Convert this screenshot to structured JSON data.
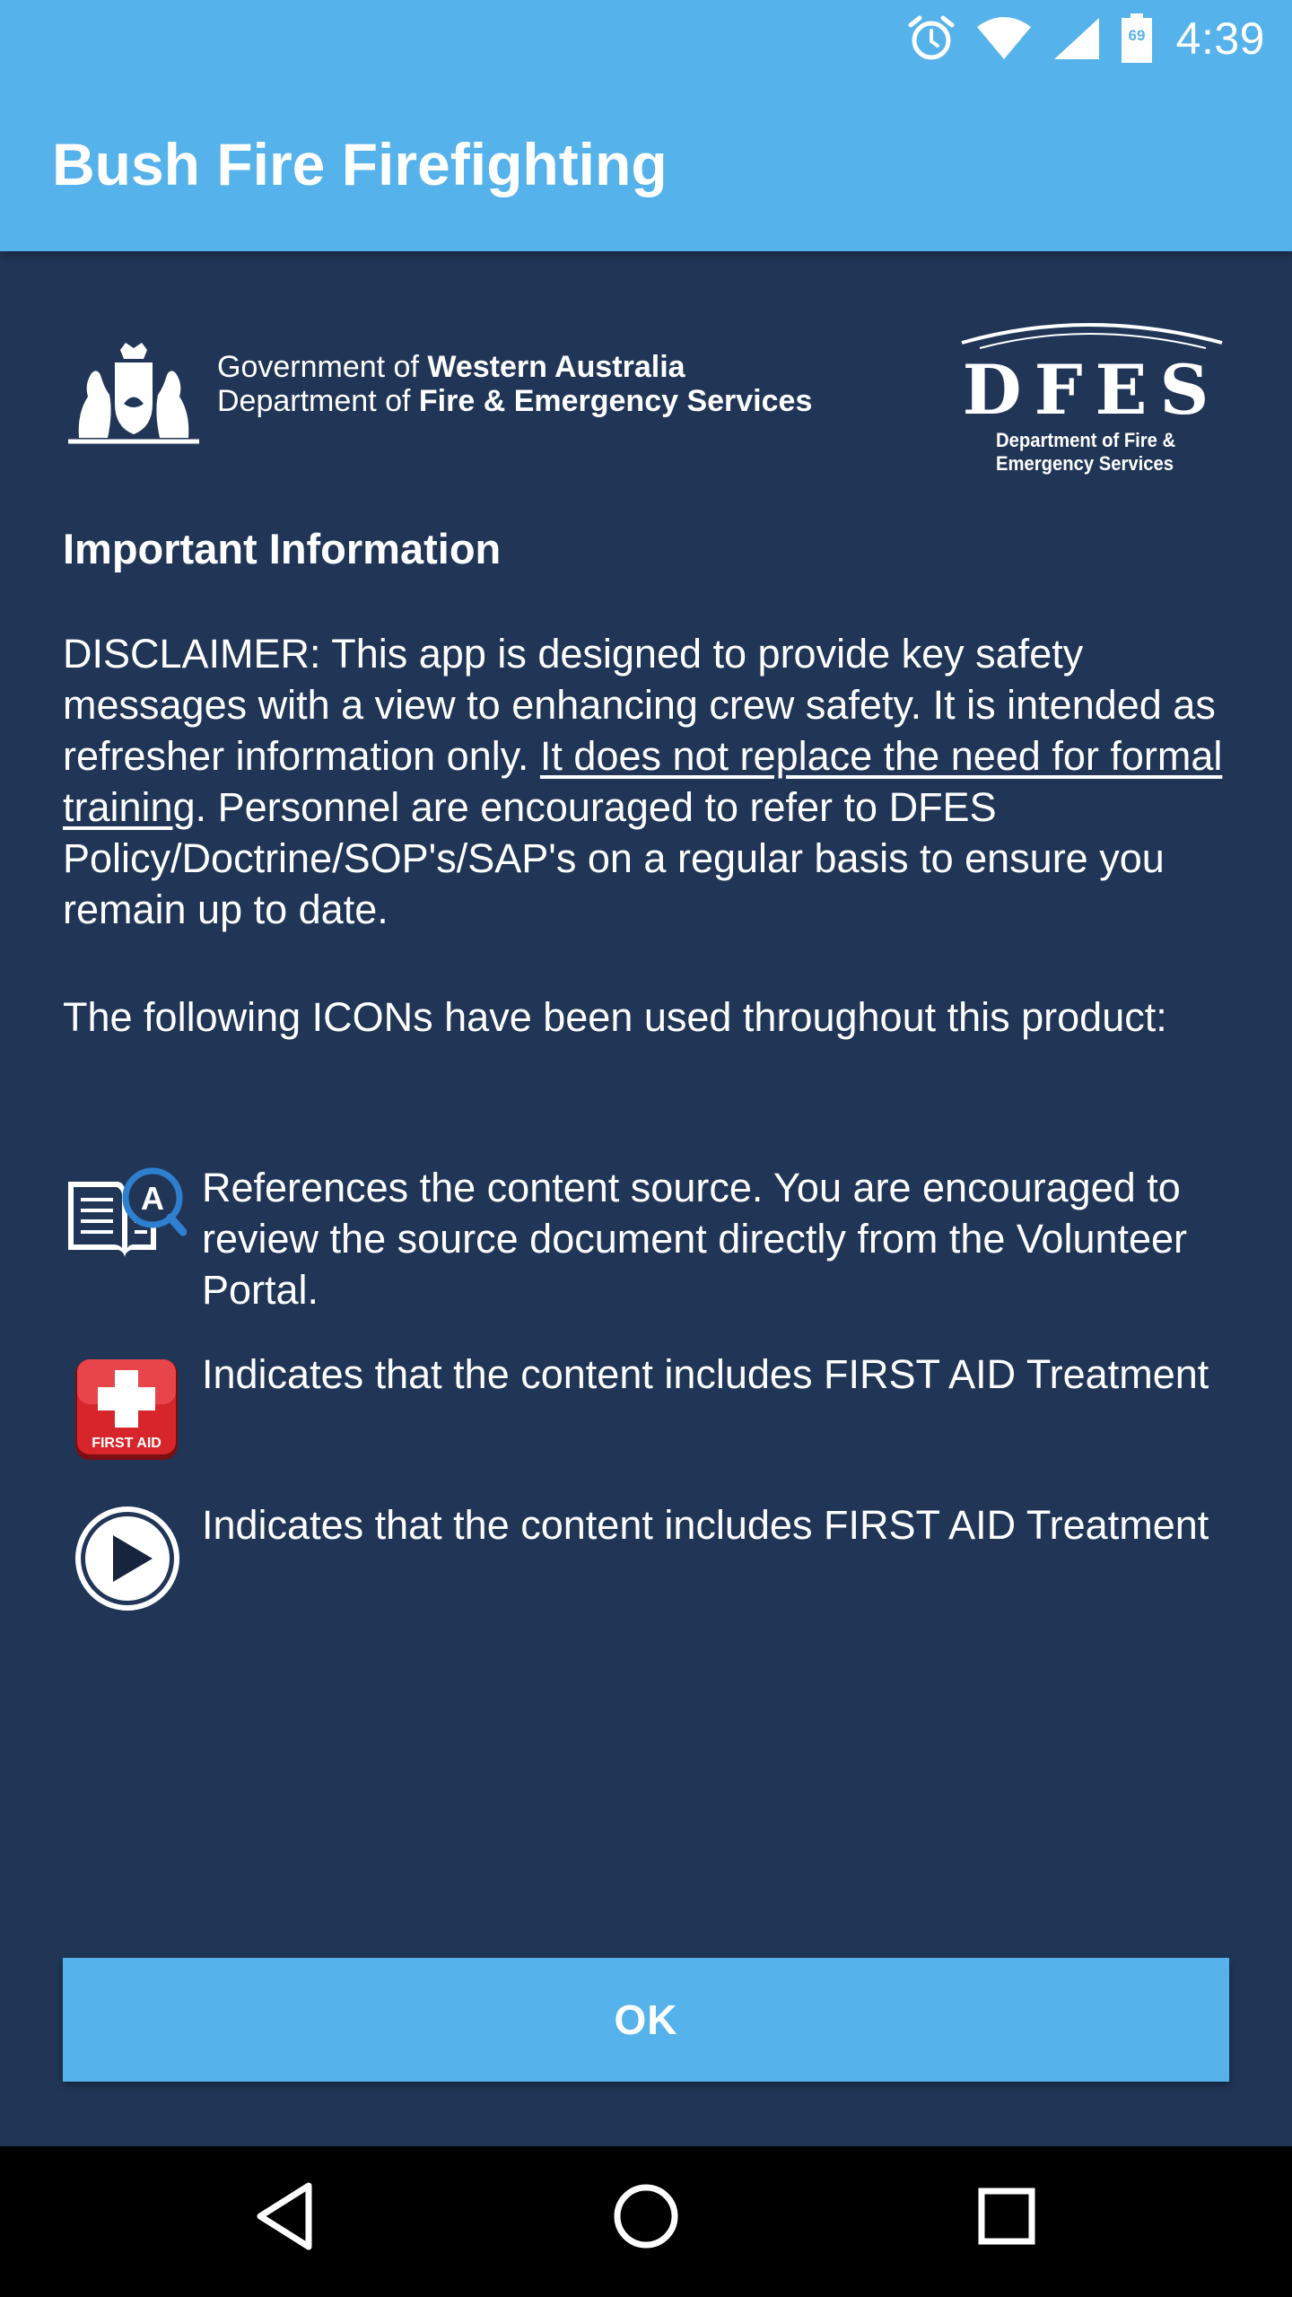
{
  "status_bar": {
    "time": "4:39",
    "battery_level": "69",
    "icons": [
      "alarm-clock-icon",
      "wifi-icon",
      "cell-signal-icon",
      "battery-icon"
    ]
  },
  "app_bar": {
    "title": "Bush Fire Firefighting"
  },
  "header": {
    "gov_line1_prefix": "Government of ",
    "gov_line1_bold": "Western Australia",
    "gov_line2_prefix": "Department of ",
    "gov_line2_bold": "Fire & Emergency Services",
    "dfes_logo_text": "DFES",
    "dfes_logo_subtitle_line1": "Department of Fire &",
    "dfes_logo_subtitle_line2": "Emergency Services"
  },
  "content": {
    "section_title": "Important Information",
    "disclaimer_part1": "DISCLAIMER: This app is designed to provide key safety messages with a view to enhancing crew safety. It is intended as refresher information only. ",
    "disclaimer_underlined": "It does not replace the need for formal training",
    "disclaimer_part2": ". Personnel are encouraged to refer to DFES Policy/Doctrine/SOP's/SAP's on a regular basis to ensure you remain up to date.",
    "icons_intro": "The following ICONs have been used throughout this product:",
    "legend": [
      {
        "icon": "reference-book-icon",
        "text": "References the content source. You are encouraged to review the source document directly from the Volunteer Portal."
      },
      {
        "icon": "first-aid-icon",
        "icon_label": "FIRST AID",
        "text": "Indicates that the content includes FIRST AID Treatment"
      },
      {
        "icon": "play-video-icon",
        "text": "Indicates that the content includes FIRST AID Treatment"
      }
    ]
  },
  "actions": {
    "ok_label": "OK"
  },
  "colors": {
    "app_bar": "#56b2ea",
    "background": "#213657",
    "button": "#56b2ea",
    "first_aid_red": "#d7262b"
  }
}
